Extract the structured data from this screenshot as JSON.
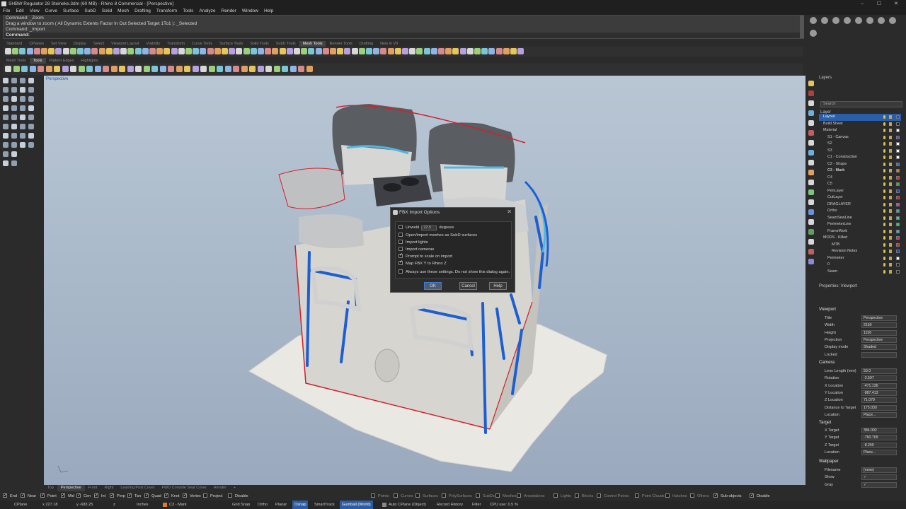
{
  "window": {
    "title": "SHBW Regulator 28 Steineke.3dm (60 MB) - Rhino 8 Commercial - [Perspective]",
    "controls": [
      "–",
      "☐",
      "✕"
    ]
  },
  "menu": [
    "File",
    "Edit",
    "View",
    "Curve",
    "Surface",
    "SubD",
    "Solid",
    "Mesh",
    "Drafting",
    "Transform",
    "Tools",
    "Analyze",
    "Render",
    "Window",
    "Help"
  ],
  "command": {
    "history": [
      "Command: _Zoom",
      "Drag a window to zoom ( All  Dynamic  Extents  Factor  In  Out  Selected  Target  1To1 ): _Selected",
      "Command: _Import"
    ],
    "prompt": "Command:"
  },
  "toolbar_tabs_top": [
    "Standard",
    "CPlanes",
    "Set View",
    "Display",
    "Select",
    "Viewport Layout",
    "Visibility",
    "Transform",
    "Curve Tools",
    "Surface Tools",
    "Solid Tools",
    "SubD Tools",
    "Mesh Tools",
    "Render Tools",
    "Drafting",
    "New in V8"
  ],
  "toolbar_tabs_top_active": "Mesh Tools",
  "toolbar_tabs_second": [
    "Mesh Tools",
    "Tools",
    "Pattern Edges",
    "Highlights"
  ],
  "toolbar_tabs_second_active": "Tools",
  "viewport": {
    "label": "Perspective"
  },
  "dialog": {
    "title": "FBX Import Options",
    "close": "✕",
    "unweld_label": "Unweld",
    "unweld_value": "22.5",
    "unweld_unit": "degrees",
    "options": [
      {
        "label": "Open/import meshes as SubD surfaces",
        "checked": false
      },
      {
        "label": "Import lights",
        "checked": false
      },
      {
        "label": "Import cameras",
        "checked": false
      },
      {
        "label": "Prompt to scale on import",
        "checked": true
      },
      {
        "label": "Map FBX Y to Rhino Z",
        "checked": true
      }
    ],
    "always_label": "Always use these settings. Do not show this dialog again.",
    "ok": "OK",
    "cancel": "Cancel",
    "help": "Help"
  },
  "layers_panel": {
    "title": "Layers",
    "search_placeholder": "Search",
    "column": "Layer",
    "rows": [
      {
        "name": "Layout",
        "color": "#1b4fd8",
        "selected": true,
        "indent": 0
      },
      {
        "name": "Build Sheet",
        "color": "#222222",
        "indent": 0
      },
      {
        "name": "Material",
        "color": "#ffffff",
        "indent": 0
      },
      {
        "name": "S1 - Canvas",
        "color": "#7b3fc4",
        "indent": 1
      },
      {
        "name": "S2",
        "color": "#ffffff",
        "indent": 1
      },
      {
        "name": "S3",
        "color": "#ffffff",
        "indent": 1
      },
      {
        "name": "C1 - Construction",
        "color": "#ffffff",
        "indent": 1
      },
      {
        "name": "C2 - Shape",
        "color": "#2d6ed6",
        "indent": 1
      },
      {
        "name": "C3 - Mark",
        "color": "#e07b2a",
        "indent": 1,
        "bold": true
      },
      {
        "name": "C4",
        "color": "#e02a2a",
        "indent": 1
      },
      {
        "name": "C5",
        "color": "#2ab83c",
        "indent": 1
      },
      {
        "name": "PenLayer",
        "color": "#2244d6",
        "indent": 1
      },
      {
        "name": "CutLayer",
        "color": "#d62222",
        "indent": 1
      },
      {
        "name": "DRAGLAYER",
        "color": "#c43fc4",
        "indent": 1
      },
      {
        "name": "Ortho",
        "color": "#2aa8d6",
        "indent": 1
      },
      {
        "name": "SeamSewLine",
        "color": "#2ad6a8",
        "indent": 1
      },
      {
        "name": "PerimeterLine",
        "color": "#2ad65a",
        "indent": 1
      },
      {
        "name": "FrameWork",
        "color": "#2ab8d6",
        "indent": 1
      },
      {
        "name": "MODS - Killed",
        "color": "#d62a6e",
        "indent": 0
      },
      {
        "name": "MTB",
        "color": "#d62a2a",
        "indent": 2
      },
      {
        "name": "Revision Notes",
        "color": "#2244d6",
        "indent": 2
      },
      {
        "name": "Perimeter",
        "color": "#ffffff",
        "indent": 1
      },
      {
        "name": "0",
        "color": "#222222",
        "indent": 1
      },
      {
        "name": "Seam",
        "color": "#222222",
        "indent": 1
      }
    ]
  },
  "properties_panel": {
    "title": "Properties: Viewport",
    "viewport_section": "Viewport",
    "viewport_rows": [
      {
        "label": "Title",
        "value": "Perspective"
      },
      {
        "label": "Width",
        "value": "2150"
      },
      {
        "label": "Height",
        "value": "1156"
      },
      {
        "label": "Projection",
        "value": "Perspective"
      },
      {
        "label": "Display mode",
        "value": "Shaded"
      },
      {
        "label": "Locked",
        "value": ""
      }
    ],
    "camera_section": "Camera",
    "camera_rows": [
      {
        "label": "Lens Length (mm)",
        "value": "50.0"
      },
      {
        "label": "Rotation",
        "value": "-2.597"
      },
      {
        "label": "X Location",
        "value": "-471.136"
      },
      {
        "label": "Y Location",
        "value": "-887.413"
      },
      {
        "label": "Z Location",
        "value": "71.079"
      },
      {
        "label": "Distance to Target",
        "value": "175.030"
      },
      {
        "label": "Location",
        "value": "Place..."
      }
    ],
    "target_section": "Target",
    "target_rows": [
      {
        "label": "X Target",
        "value": "384.002"
      },
      {
        "label": "Y Target",
        "value": "-760.709"
      },
      {
        "label": "Z Target",
        "value": "-8.250"
      },
      {
        "label": "Location",
        "value": "Place..."
      }
    ],
    "wallpaper_section": "Wallpaper",
    "wallpaper_rows": [
      {
        "label": "Filename",
        "value": "(none)"
      },
      {
        "label": "Show",
        "value": "✓"
      },
      {
        "label": "Gray",
        "value": "✓"
      }
    ]
  },
  "view_tabs": [
    "Top",
    "Perspective",
    "Front",
    "Right",
    "Leaning Post Cover",
    "FWD Console Seat Cover",
    "Render",
    "+"
  ],
  "view_tabs_active": "Perspective",
  "osnaps": [
    {
      "label": "End",
      "checked": true
    },
    {
      "label": "Near",
      "checked": true
    },
    {
      "label": "Point",
      "checked": true
    },
    {
      "label": "Mid",
      "checked": true
    },
    {
      "label": "Cen",
      "checked": true
    },
    {
      "label": "Int",
      "checked": true
    },
    {
      "label": "Perp",
      "checked": true
    },
    {
      "label": "Tan",
      "checked": true
    },
    {
      "label": "Quad",
      "checked": true
    },
    {
      "label": "Knot",
      "checked": true
    },
    {
      "label": "Vertex",
      "checked": true
    },
    {
      "label": "Project",
      "checked": false
    },
    {
      "label": "Disable",
      "checked": false
    }
  ],
  "filters": [
    "Points",
    "Curves",
    "Surfaces",
    "PolySurfaces",
    "SubDs",
    "Meshes",
    "Annotations",
    "Lights",
    "Blocks",
    "Control Points",
    "Point Clouds",
    "Hatches",
    "Others",
    "Sub-objects",
    "Disable"
  ],
  "status": {
    "cplane": "CPlane",
    "x": "x 227.18",
    "y": "y -683.25",
    "z": "z",
    "units": "Inches",
    "layer": "C3 - Mark",
    "grid_snap": "Grid Snap",
    "ortho": "Ortho",
    "planar": "Planar",
    "osnap": "Osnap",
    "smarttrack": "SmartTrack",
    "gumball": "Gumball (World)",
    "auto_cplane": "Auto CPlane (Object)",
    "record_history": "Record History",
    "filter": "Filter",
    "cpu": "CPU use: 0.5 %"
  },
  "colors": {
    "accent": "#2d5ca0",
    "selection": "#2a5ea8"
  }
}
